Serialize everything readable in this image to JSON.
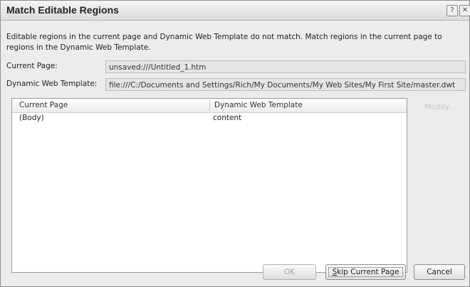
{
  "dialog": {
    "title": "Match Editable Regions",
    "help_glyph": "?",
    "close_glyph": "✕"
  },
  "description": "Editable regions in the current page and Dynamic Web Template do not match. Match regions in the current page to regions in the Dynamic Web Template.",
  "fields": {
    "current_page_label": "Current Page:",
    "current_page_value": "unsaved:///Untitled_1.htm",
    "dwt_label": "Dynamic Web Template:",
    "dwt_value": "file:///C:/Documents and Settings/Rich/My Documents/My Web Sites/My First Site/master.dwt"
  },
  "table": {
    "headers": [
      "Current Page",
      "Dynamic Web Template"
    ],
    "rows": [
      {
        "current_page": "(Body)",
        "dwt": "content"
      }
    ]
  },
  "buttons": {
    "modify": "Modify...",
    "ok": "OK",
    "skip_first": "S",
    "skip_rest": "kip Current Page",
    "cancel": "Cancel"
  }
}
